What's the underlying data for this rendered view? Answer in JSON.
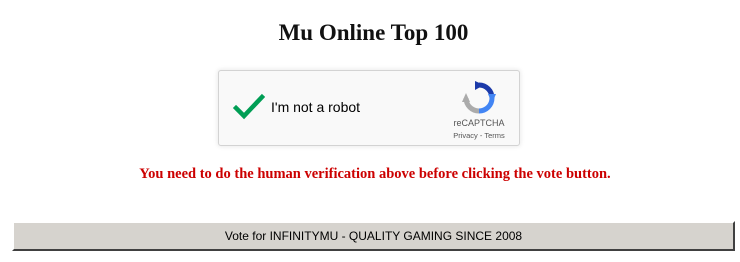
{
  "page": {
    "title": "Mu Online Top 100"
  },
  "captcha": {
    "checkbox_label": "I'm not a robot",
    "checked": true,
    "brand": "reCAPTCHA",
    "privacy_link": "Privacy",
    "separator": " - ",
    "terms_link": "Terms",
    "check_color": "#009e55",
    "icon": "recaptcha-logo-icon"
  },
  "warning": {
    "text": "You need to do the human verification above before clicking the vote button.",
    "color": "#cc0000"
  },
  "vote_button": {
    "label": "Vote for INFINITYMU - QUALITY GAMING SINCE 2008"
  }
}
